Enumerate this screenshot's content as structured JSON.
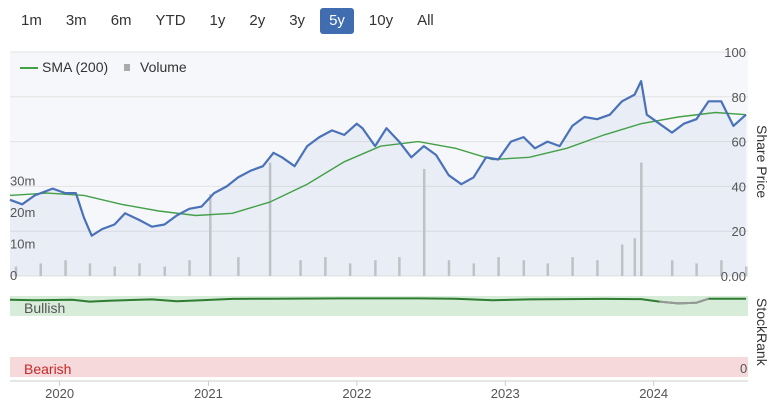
{
  "range_buttons": [
    {
      "label": "1m",
      "active": false
    },
    {
      "label": "3m",
      "active": false
    },
    {
      "label": "6m",
      "active": false
    },
    {
      "label": "YTD",
      "active": false
    },
    {
      "label": "1y",
      "active": false
    },
    {
      "label": "2y",
      "active": false
    },
    {
      "label": "3y",
      "active": false
    },
    {
      "label": "5y",
      "active": true
    },
    {
      "label": "10y",
      "active": false
    },
    {
      "label": "All",
      "active": false
    }
  ],
  "chart_data": {
    "type": "line",
    "legend": {
      "placement": "top-left",
      "sma_label": "SMA (200)",
      "volume_label": "Volume"
    },
    "x_ticks": [
      "2020",
      "2021",
      "2022",
      "2023",
      "2024"
    ],
    "price_axis": {
      "label": "Share Price",
      "ylim": [
        0,
        100
      ],
      "ticks": [
        "100",
        "80",
        "60",
        "40",
        "20",
        "0.00"
      ]
    },
    "volume_axis": {
      "ylim": [
        0,
        40
      ],
      "ticks": [
        "30m",
        "20m",
        "10m",
        "0"
      ]
    },
    "stockrank": {
      "label": "StockRank",
      "top_band": "Bullish",
      "bottom_band": "Bearish",
      "bottom_value": "0"
    },
    "colors": {
      "price": "#4a72b8",
      "sma": "#43a047",
      "volume": "#c8c8c8",
      "bullish_band": "#d7ecd9",
      "bearish_band": "#f6d9db",
      "rank_line": "#2e7d32",
      "rank_low": "#999999"
    },
    "series_price": [
      [
        "2019-09-01",
        34
      ],
      [
        "2019-10-01",
        32
      ],
      [
        "2019-11-01",
        36
      ],
      [
        "2019-12-15",
        39
      ],
      [
        "2020-01-15",
        37
      ],
      [
        "2020-02-10",
        37
      ],
      [
        "2020-03-01",
        26
      ],
      [
        "2020-03-20",
        18
      ],
      [
        "2020-04-15",
        21
      ],
      [
        "2020-05-15",
        23
      ],
      [
        "2020-06-10",
        28
      ],
      [
        "2020-07-15",
        25
      ],
      [
        "2020-08-15",
        22
      ],
      [
        "2020-09-15",
        23
      ],
      [
        "2020-10-15",
        27
      ],
      [
        "2020-11-15",
        30
      ],
      [
        "2020-12-15",
        31
      ],
      [
        "2021-01-15",
        37
      ],
      [
        "2021-02-15",
        40
      ],
      [
        "2021-03-15",
        44
      ],
      [
        "2021-04-15",
        47
      ],
      [
        "2021-05-15",
        49
      ],
      [
        "2021-06-10",
        55
      ],
      [
        "2021-07-01",
        53
      ],
      [
        "2021-08-01",
        49
      ],
      [
        "2021-09-01",
        58
      ],
      [
        "2021-10-01",
        62
      ],
      [
        "2021-11-01",
        65
      ],
      [
        "2021-12-01",
        63
      ],
      [
        "2022-01-01",
        68
      ],
      [
        "2022-01-15",
        66
      ],
      [
        "2022-02-15",
        58
      ],
      [
        "2022-03-15",
        66
      ],
      [
        "2022-04-15",
        60
      ],
      [
        "2022-05-15",
        53
      ],
      [
        "2022-06-15",
        58
      ],
      [
        "2022-07-15",
        54
      ],
      [
        "2022-08-15",
        45
      ],
      [
        "2022-09-15",
        41
      ],
      [
        "2022-10-15",
        44
      ],
      [
        "2022-11-15",
        53
      ],
      [
        "2022-12-15",
        52
      ],
      [
        "2023-01-15",
        60
      ],
      [
        "2023-02-15",
        62
      ],
      [
        "2023-03-15",
        57
      ],
      [
        "2023-04-15",
        60
      ],
      [
        "2023-05-15",
        58
      ],
      [
        "2023-06-15",
        67
      ],
      [
        "2023-07-15",
        71
      ],
      [
        "2023-08-15",
        70
      ],
      [
        "2023-09-15",
        72
      ],
      [
        "2023-10-15",
        78
      ],
      [
        "2023-11-15",
        81
      ],
      [
        "2023-12-01",
        87
      ],
      [
        "2023-12-15",
        72
      ],
      [
        "2024-01-15",
        68
      ],
      [
        "2024-02-15",
        64
      ],
      [
        "2024-03-15",
        68
      ],
      [
        "2024-04-15",
        70
      ],
      [
        "2024-05-15",
        78
      ],
      [
        "2024-06-15",
        78
      ],
      [
        "2024-07-15",
        67
      ],
      [
        "2024-08-15",
        72
      ]
    ],
    "series_sma": [
      [
        "2019-09-01",
        36
      ],
      [
        "2019-12-01",
        37
      ],
      [
        "2020-03-01",
        36
      ],
      [
        "2020-06-01",
        32
      ],
      [
        "2020-09-01",
        29
      ],
      [
        "2020-12-01",
        27
      ],
      [
        "2021-03-01",
        28
      ],
      [
        "2021-06-01",
        33
      ],
      [
        "2021-09-01",
        41
      ],
      [
        "2021-12-01",
        51
      ],
      [
        "2022-03-01",
        58
      ],
      [
        "2022-06-01",
        60
      ],
      [
        "2022-09-01",
        57
      ],
      [
        "2022-12-01",
        52
      ],
      [
        "2023-03-01",
        53
      ],
      [
        "2023-06-01",
        57
      ],
      [
        "2023-09-01",
        63
      ],
      [
        "2023-12-01",
        68
      ],
      [
        "2024-03-01",
        71
      ],
      [
        "2024-06-01",
        73
      ],
      [
        "2024-08-15",
        72
      ]
    ],
    "series_volume": [
      [
        "2019-09-15",
        3
      ],
      [
        "2019-11-15",
        4
      ],
      [
        "2020-01-15",
        5
      ],
      [
        "2020-03-15",
        4
      ],
      [
        "2020-05-15",
        3
      ],
      [
        "2020-07-15",
        4
      ],
      [
        "2020-09-15",
        3
      ],
      [
        "2020-11-15",
        5
      ],
      [
        "2021-01-05",
        26
      ],
      [
        "2021-03-15",
        6
      ],
      [
        "2021-06-01",
        36
      ],
      [
        "2021-08-15",
        5
      ],
      [
        "2021-10-15",
        6
      ],
      [
        "2021-12-15",
        4
      ],
      [
        "2022-02-15",
        5
      ],
      [
        "2022-04-15",
        6
      ],
      [
        "2022-06-15",
        34
      ],
      [
        "2022-08-15",
        5
      ],
      [
        "2022-10-15",
        4
      ],
      [
        "2022-12-15",
        6
      ],
      [
        "2023-02-15",
        5
      ],
      [
        "2023-04-15",
        4
      ],
      [
        "2023-06-15",
        6
      ],
      [
        "2023-08-15",
        5
      ],
      [
        "2023-10-15",
        10
      ],
      [
        "2023-11-15",
        12
      ],
      [
        "2023-12-01",
        36
      ],
      [
        "2024-02-15",
        5
      ],
      [
        "2024-04-15",
        4
      ],
      [
        "2024-06-15",
        5
      ],
      [
        "2024-08-15",
        3
      ]
    ],
    "series_stockrank": [
      [
        "2019-09-01",
        90
      ],
      [
        "2019-11-01",
        88
      ],
      [
        "2020-02-01",
        90
      ],
      [
        "2020-03-15",
        80
      ],
      [
        "2020-05-01",
        85
      ],
      [
        "2020-08-15",
        92
      ],
      [
        "2020-10-15",
        82
      ],
      [
        "2020-12-15",
        88
      ],
      [
        "2021-03-01",
        95
      ],
      [
        "2021-06-01",
        96
      ],
      [
        "2021-12-01",
        98
      ],
      [
        "2022-06-01",
        98
      ],
      [
        "2022-09-01",
        96
      ],
      [
        "2022-12-01",
        88
      ],
      [
        "2023-03-01",
        92
      ],
      [
        "2023-06-01",
        94
      ],
      [
        "2023-09-01",
        95
      ],
      [
        "2023-12-01",
        94
      ],
      [
        "2024-01-15",
        80
      ],
      [
        "2024-03-01",
        70
      ],
      [
        "2024-04-15",
        74
      ],
      [
        "2024-05-15",
        96
      ],
      [
        "2024-08-15",
        96
      ]
    ]
  }
}
